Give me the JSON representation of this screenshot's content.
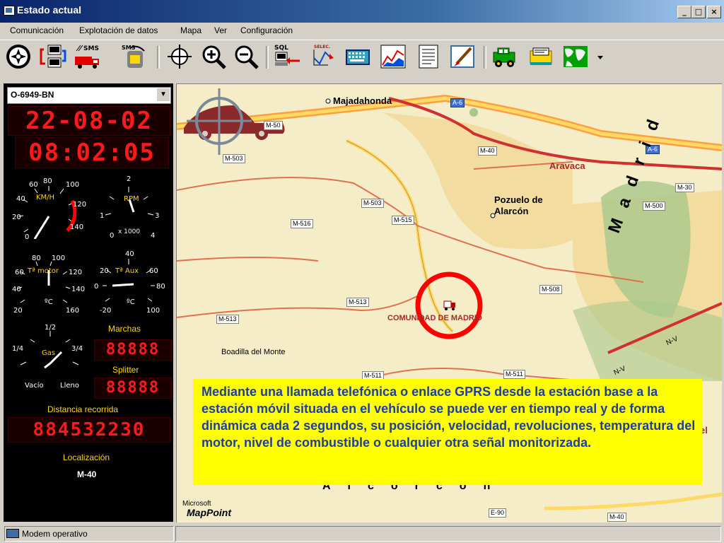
{
  "window": {
    "title": "Estado actual"
  },
  "window_buttons": {
    "minimize": "_",
    "maximize": "□",
    "close": "×"
  },
  "menu": [
    "Comunicación",
    "Explotación de datos",
    "Mapa",
    "Ver",
    "Configuración"
  ],
  "toolbar": {
    "sms_label": "SMS",
    "sms2_label": "SMS",
    "sql_label": "SQL",
    "select_label": "SELEC."
  },
  "vehicle": {
    "id": "O-6949-BN",
    "dropdown_icon": "▼"
  },
  "date_display": "22-08-02",
  "time_display": "08:02:05",
  "gauges": {
    "speed": {
      "unit": "KM/H",
      "ticks": [
        "0",
        "20",
        "40",
        "60",
        "80",
        "100",
        "120",
        "140"
      ]
    },
    "rpm": {
      "unit": "RPM",
      "sub": "x 1000",
      "ticks": [
        "0",
        "1",
        "2",
        "3",
        "4"
      ]
    },
    "motor_temp": {
      "unit": "Tª motor",
      "sub": "ºC",
      "ticks": [
        "20",
        "40",
        "60",
        "80",
        "100",
        "120",
        "140",
        "160"
      ]
    },
    "aux_temp": {
      "unit": "Tª Aux",
      "sub": "ºC",
      "ticks": [
        "-20",
        "0",
        "20",
        "40",
        "60",
        "80",
        "100"
      ]
    },
    "gas": {
      "unit": "Gas",
      "ticks": [
        "Vacío",
        "1/4",
        "1/2",
        "3/4",
        "Lleno"
      ]
    }
  },
  "labels": {
    "marchas": "Marchas",
    "splitter": "Splitter",
    "distancia": "Distancia recorrida",
    "localizacion": "Localización"
  },
  "marchas_display": "88888",
  "splitter_display": "88888",
  "distance_display": "884532230",
  "location": "M-40",
  "map": {
    "places": [
      "Majadahonda",
      "Aravaca",
      "Pozuelo de",
      "Alarcón",
      "COMUNIDAD DE MADRID",
      "Boadilla del Monte",
      "Madrid",
      "Alcorcón",
      "el"
    ],
    "roads": [
      "A-6",
      "M-50",
      "M-503",
      "M-40",
      "A-6",
      "M-30",
      "M-503",
      "M-516",
      "M-515",
      "M-500",
      "M-508",
      "M-513",
      "M-513",
      "M-511",
      "M-511",
      "E-90",
      "M-40",
      "N-V",
      "N-V"
    ],
    "vendor_small": "Microsoft",
    "vendor_logo": "MapPoint",
    "marker_color": "#ff0000"
  },
  "info_text": "Mediante una llamada telefónica o enlace GPRS desde la estación base a la estación móvil situada en el vehículo se puede ver en tiempo real y de forma dinámica cada 2 segundos, su posición, velocidad, revoluciones, temperatura del motor, nivel de combustible o cualquier otra señal monitorizada.",
  "status": {
    "text": "Modem operativo"
  },
  "colors": {
    "lcd": "#ff1a1a",
    "info_bg": "#ffff00",
    "info_text": "#1f3fa0",
    "titlebar": "#0a246a"
  }
}
